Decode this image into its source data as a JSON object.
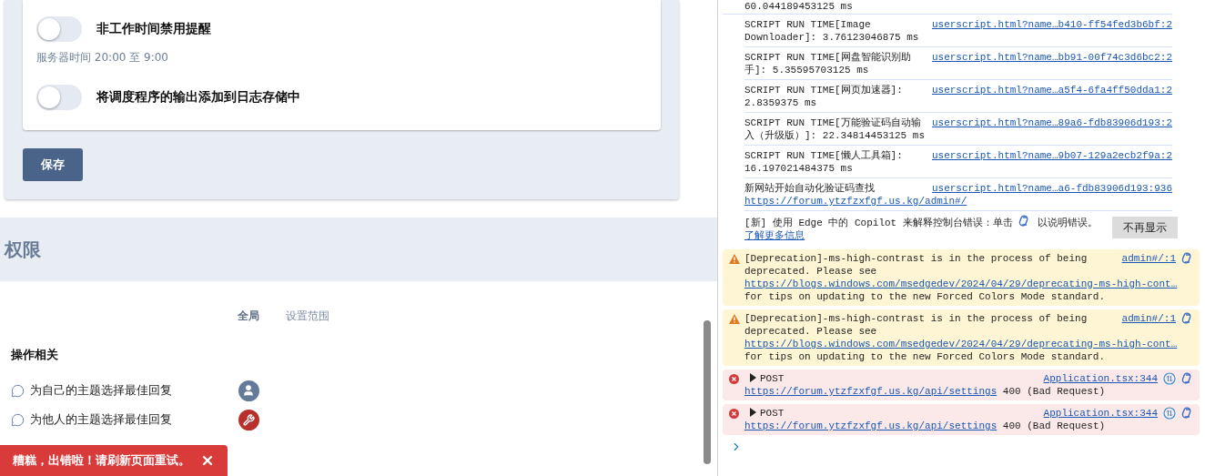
{
  "settings": {
    "items": [
      {
        "kind": "toggle",
        "label": "非工作时间禁用提醒",
        "on": false
      },
      {
        "kind": "hint",
        "text": "服务器时间 20:00 至 9:00"
      },
      {
        "kind": "toggle",
        "label": "将调度程序的输出添加到日志存储中",
        "on": false
      }
    ],
    "save_button": "保存"
  },
  "permissions": {
    "title": "权限",
    "columns": [
      "全局",
      "设置范围"
    ],
    "group": "操作相关",
    "rows": [
      {
        "label": "为自己的主题选择最佳回复",
        "kind": "user",
        "color": "#647a99"
      },
      {
        "label": "为他人的主题选择最佳回复",
        "kind": "admin",
        "color": "#b8302c"
      }
    ]
  },
  "toast": {
    "text": "糟糕，出错啦！请刷新页面重试。"
  },
  "console": {
    "top_line": "60.044189453125 ms",
    "entries": [
      {
        "kind": "log",
        "text": "SCRIPT RUN TIME[Image Downloader]: 3.76123046875 ms",
        "source": "userscript.html?name…b410-ff54fed3b6bf:2"
      },
      {
        "kind": "log",
        "text": "SCRIPT RUN TIME[网盘智能识别助手]: 5.35595703125 ms",
        "source": "userscript.html?name…bb91-00f74c3d6bc2:2"
      },
      {
        "kind": "log",
        "text": "SCRIPT RUN TIME[网页加速器]: 2.8359375 ms",
        "source": "userscript.html?name…a5f4-6fa4ff50dda1:2"
      },
      {
        "kind": "log",
        "text": "SCRIPT RUN TIME[万能验证码自动输入（升级版）]: 22.34814453125 ms",
        "source": "userscript.html?name…89a6-fdb83906d193:2"
      },
      {
        "kind": "log",
        "text": "SCRIPT RUN TIME[懒人工具箱]: 16.197021484375 ms",
        "source": "userscript.html?name…9b07-129a2ecb2f9a:2"
      },
      {
        "kind": "log",
        "text": "新网站开始自动化验证码查找",
        "link": "https://forum.ytzfzxfgf.us.kg/admin#/",
        "source": "userscript.html?name…a6-fdb83906d193:936"
      },
      {
        "kind": "info",
        "text": "[新] 使用 Edge 中的 Copilot 来解释控制台错误：单击",
        "after": "以说明错误。",
        "link": "了解更多信息",
        "button": "不再显示"
      },
      {
        "kind": "warning",
        "text": "[Deprecation]-ms-high-contrast is in the process of being deprecated. Please see",
        "link": "https://blogs.windows.com/msedgedev/2024/04/29/deprecating-ms-high-cont…",
        "after": "for tips on updating to the new Forced Colors Mode standard.",
        "source": "admin#/:1"
      },
      {
        "kind": "warning",
        "text": "[Deprecation]-ms-high-contrast is in the process of being deprecated. Please see",
        "link": "https://blogs.windows.com/msedgedev/2024/04/29/deprecating-ms-high-cont…",
        "after": "for tips on updating to the new Forced Colors Mode standard.",
        "source": "admin#/:1"
      },
      {
        "kind": "error",
        "text": "POST",
        "link": "https://forum.ytzfzxfgf.us.kg/api/settings",
        "after": "400 (Bad Request)",
        "source": "Application.tsx:344"
      },
      {
        "kind": "error",
        "text": "POST",
        "link": "https://forum.ytzfzxfgf.us.kg/api/settings",
        "after": "400 (Bad Request)",
        "source": "Application.tsx:344"
      }
    ]
  }
}
